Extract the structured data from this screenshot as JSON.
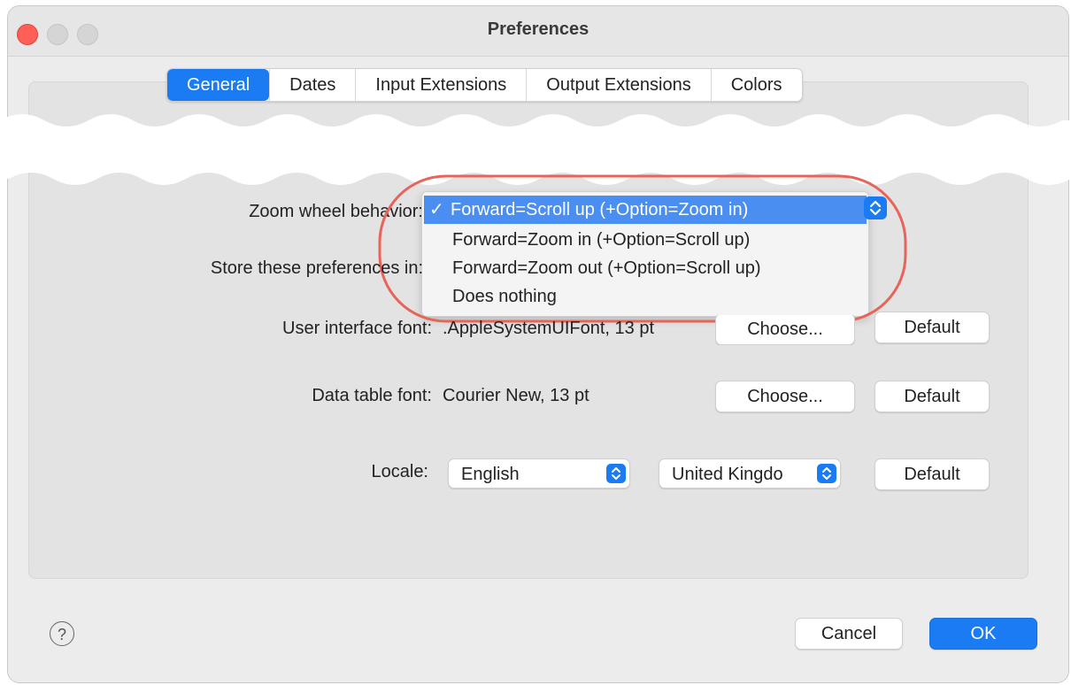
{
  "window": {
    "title": "Preferences"
  },
  "tabs": [
    {
      "label": "General",
      "active": true
    },
    {
      "label": "Dates",
      "active": false
    },
    {
      "label": "Input Extensions",
      "active": false
    },
    {
      "label": "Output Extensions",
      "active": false
    },
    {
      "label": "Colors",
      "active": false
    }
  ],
  "zoom": {
    "label": "Zoom wheel behavior:",
    "options": [
      {
        "label": "Forward=Scroll up (+Option=Zoom in)",
        "selected": true,
        "check": "✓"
      },
      {
        "label": "Forward=Zoom in (+Option=Scroll up)",
        "selected": false
      },
      {
        "label": "Forward=Zoom out (+Option=Scroll up)",
        "selected": false
      },
      {
        "label": "Does nothing",
        "selected": false
      }
    ]
  },
  "store": {
    "label": "Store these preferences in:"
  },
  "ui_font": {
    "label": "User interface font:",
    "value": ".AppleSystemUIFont, 13 pt",
    "choose_label": "Choose...",
    "default_label": "Default"
  },
  "table_font": {
    "label": "Data table font:",
    "value": "Courier New, 13 pt",
    "choose_label": "Choose...",
    "default_label": "Default"
  },
  "locale": {
    "label": "Locale:",
    "language": "English",
    "region": "United Kingdo",
    "default_label": "Default"
  },
  "footer": {
    "help_symbol": "?",
    "cancel_label": "Cancel",
    "ok_label": "OK"
  },
  "colors": {
    "accent": "#1a7bf2",
    "highlight_oval": "#e8645a",
    "close": "#ff5f57"
  }
}
